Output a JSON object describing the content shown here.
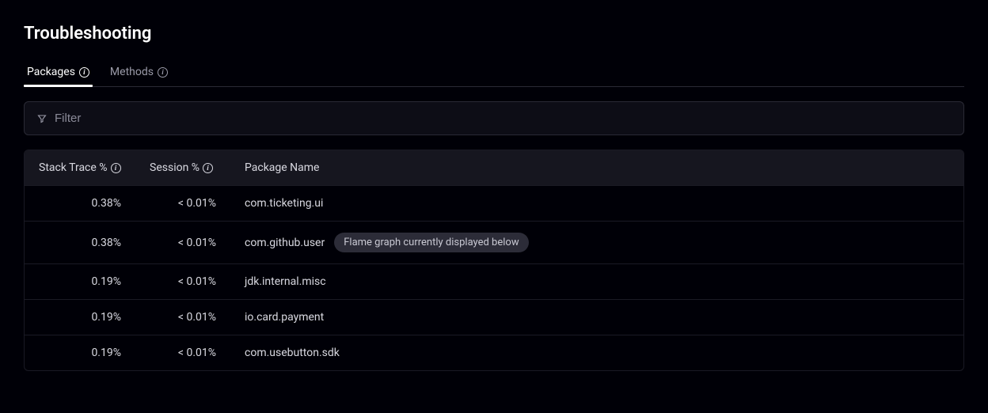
{
  "title": "Troubleshooting",
  "tabs": {
    "packages": "Packages",
    "methods": "Methods"
  },
  "filter": {
    "placeholder": "Filter"
  },
  "columns": {
    "stack": "Stack Trace %",
    "session": "Session %",
    "name": "Package Name"
  },
  "rows": [
    {
      "stack": "0.38%",
      "session": "< 0.01%",
      "name": "com.ticketing.ui",
      "badge": null
    },
    {
      "stack": "0.38%",
      "session": "< 0.01%",
      "name": "com.github.user",
      "badge": "Flame graph currently displayed below"
    },
    {
      "stack": "0.19%",
      "session": "< 0.01%",
      "name": "jdk.internal.misc",
      "badge": null
    },
    {
      "stack": "0.19%",
      "session": "< 0.01%",
      "name": "io.card.payment",
      "badge": null
    },
    {
      "stack": "0.19%",
      "session": "< 0.01%",
      "name": "com.usebutton.sdk",
      "badge": null
    }
  ]
}
